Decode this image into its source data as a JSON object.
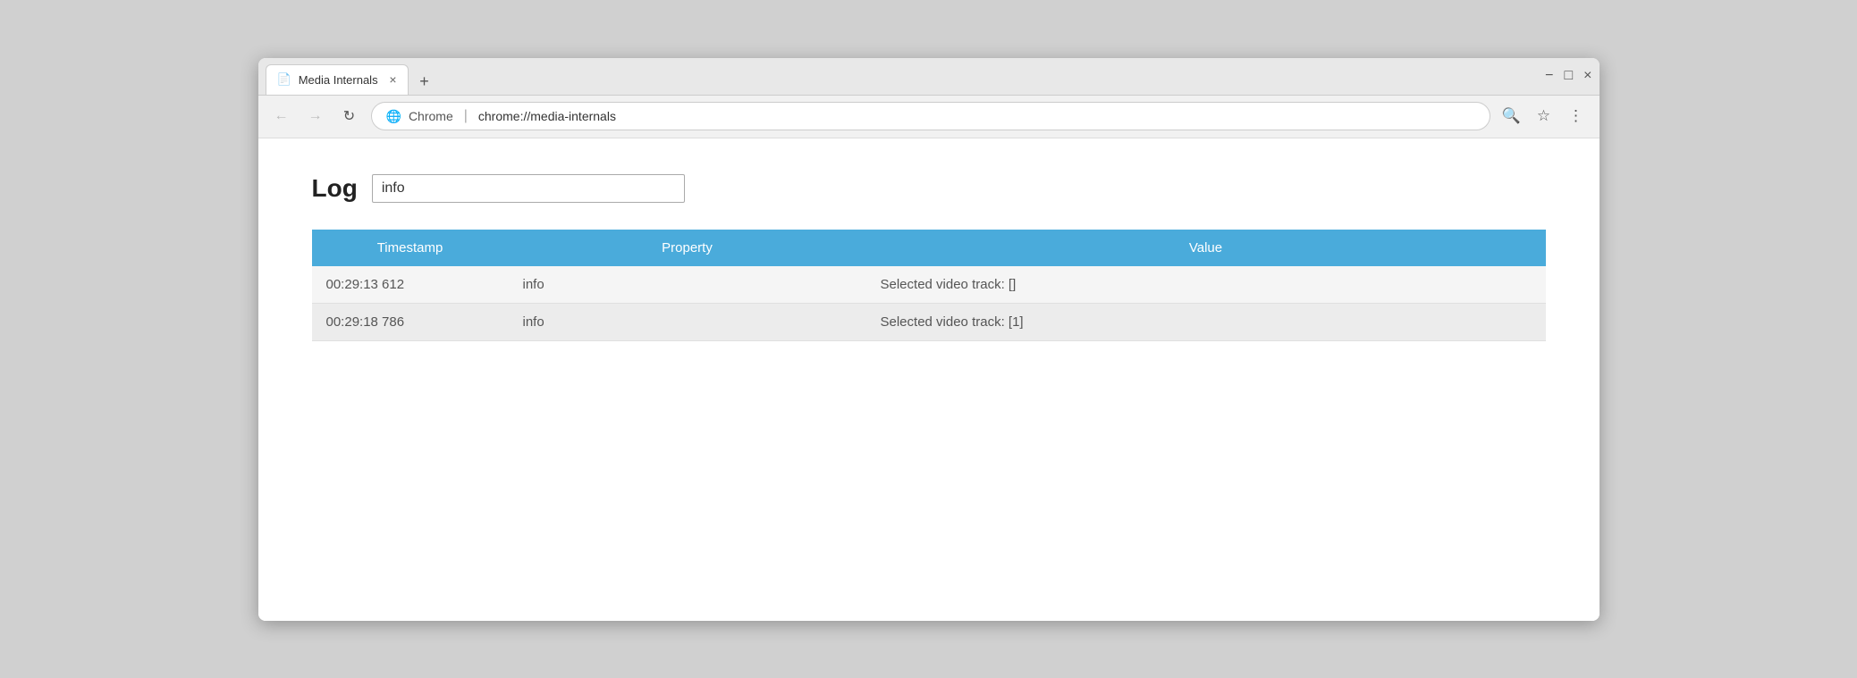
{
  "window": {
    "title": "Media Internals",
    "tab_icon": "📄",
    "close_label": "×",
    "minimize_label": "−",
    "maximize_label": "□"
  },
  "addressbar": {
    "back_icon": "←",
    "forward_icon": "→",
    "reload_icon": "↻",
    "security_icon": "🌐",
    "domain": "Chrome",
    "separator": "|",
    "path": "chrome://media-internals",
    "search_icon": "🔍",
    "star_icon": "☆",
    "menu_icon": "⋮"
  },
  "page": {
    "log_label": "Log",
    "log_input_value": "info",
    "log_input_placeholder": ""
  },
  "table": {
    "headers": [
      "Timestamp",
      "Property",
      "Value"
    ],
    "rows": [
      {
        "timestamp": "00:29:13 612",
        "property": "info",
        "value": "Selected video track: []"
      },
      {
        "timestamp": "00:29:18 786",
        "property": "info",
        "value": "Selected video track: [1]"
      }
    ]
  }
}
